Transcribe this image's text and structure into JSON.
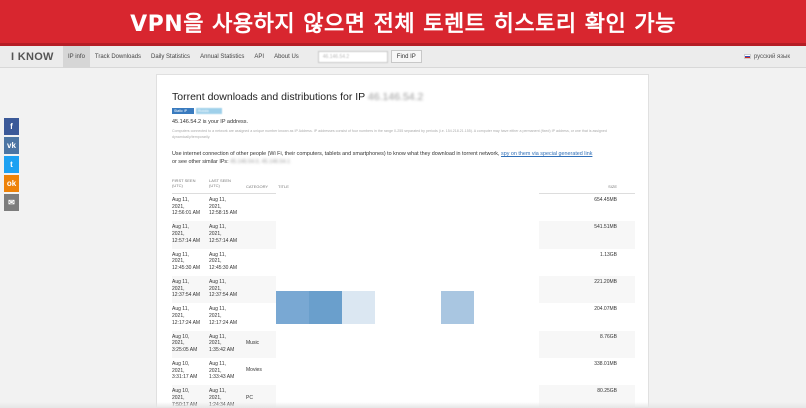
{
  "banner": {
    "text": "VPN을 사용하지 않으면 전체 토렌트 히스토리 확인 가능"
  },
  "nav": {
    "logo": "I KNOW",
    "items": [
      "IP info",
      "Track Downloads",
      "Daily Statistics",
      "Annual Statistics",
      "API",
      "About Us"
    ],
    "search_value": "46.146.54.2",
    "find_button": "Find IP",
    "language": "русский язык"
  },
  "social": [
    {
      "name": "facebook",
      "glyph": "f",
      "color": "#3b5998"
    },
    {
      "name": "vk",
      "glyph": "vk",
      "color": "#4c75a3"
    },
    {
      "name": "twitter",
      "glyph": "t",
      "color": "#1da1f2"
    },
    {
      "name": "odnoklassniki",
      "glyph": "ok",
      "color": "#ee8208"
    },
    {
      "name": "email",
      "glyph": "✉",
      "color": "#7d7d7d"
    }
  ],
  "page": {
    "title": "Torrent downloads and distributions for IP",
    "title_ip": "46.146.54.2",
    "badge_1": "Static IP",
    "badge_2": "Russia",
    "ip_line": "45.146.54.2 is your IP address.",
    "fine_print": "Computers connected to a network are assigned a unique number known as IP Address. IP addresses consist of four numbers in the range 0-255 separated by periods (i.e. 154.218.21.155). A computer may have either a permanent (fixed) IP address, or one that is assigned dynamically/temporarily.",
    "para_start": "Use internet connection of other people (Wi Fi, their computers, tablets and smartphones) to know what they download in torrent network,",
    "para_link": "spy on them via special generated link",
    "para_end": "or see other similar IPs:",
    "similar_ips": "45.146.54.0, 45.146.54.1"
  },
  "table": {
    "headers": {
      "first_seen": "FIRST SEEN\n(UTC)",
      "last_seen": "LAST SEEN\n(UTC)",
      "category": "CATEGORY",
      "title": "TITLE",
      "size": "SIZE"
    },
    "rows": [
      {
        "first": "Aug 11,\n2021,\n12:56:01 AM",
        "last": "Aug 11,\n2021,\n12:58:15 AM",
        "category": "",
        "size": "654.45MB"
      },
      {
        "first": "Aug 11,\n2021,\n12:57:14 AM",
        "last": "Aug 11,\n2021,\n12:57:14 AM",
        "category": "",
        "size": "541.51MB"
      },
      {
        "first": "Aug 11,\n2021,\n12:45:30 AM",
        "last": "Aug 11,\n2021,\n12:45:30 AM",
        "category": "",
        "size": "1.13GB"
      },
      {
        "first": "Aug 11,\n2021,\n12:37:54 AM",
        "last": "Aug 11,\n2021,\n12:37:54 AM",
        "category": "",
        "size": "221.20MB"
      },
      {
        "first": "Aug 11,\n2021,\n12:17:24 AM",
        "last": "Aug 11,\n2021,\n12:17:24 AM",
        "category": "",
        "size": "204.07MB"
      },
      {
        "first": "Aug 10,\n2021,\n3:25:05 AM",
        "last": "Aug 11,\n2021,\n1:35:42 AM",
        "category": "Music",
        "size": "8.76GB"
      },
      {
        "first": "Aug 10,\n2021,\n3:31:17 AM",
        "last": "Aug 11,\n2021,\n1:33:43 AM",
        "category": "Movies",
        "size": "338.01MB"
      },
      {
        "first": "Aug 10,\n2021,\n7:50:17 AM",
        "last": "Aug 11,\n2021,\n1:24:34 AM",
        "category": "PC",
        "size": "80.25GB"
      }
    ]
  },
  "colors": {
    "banner": "#d8262f",
    "link": "#2f6fb8",
    "heat_dark": "#6a9fcc",
    "heat_mid": "#79a8d3",
    "heat_light": "#a9c6e1"
  }
}
